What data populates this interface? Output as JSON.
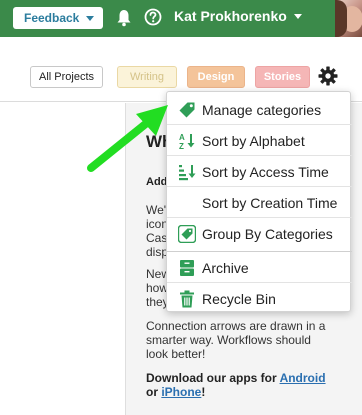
{
  "topbar": {
    "feedback_label": "Feedback",
    "user_name": "Kat Prokhorenko",
    "accent_color": "#3b8a4a"
  },
  "toolbar": {
    "all_projects": "All Projects",
    "writing": "Writing",
    "design": "Design",
    "stories": "Stories"
  },
  "panel": {
    "title_fragment": "Wh",
    "heading_fragment": "Add",
    "p1": [
      "We'",
      "icon",
      "Cas",
      "disp"
    ],
    "p2": [
      "New",
      "how",
      "they"
    ],
    "p3": [
      "Connection arrows are drawn in a",
      "smarter way. Workflows should",
      "look better!"
    ],
    "apps_prefix": "Download our apps for",
    "android": "Android",
    "or": "or",
    "iphone": "iPhone",
    "apps_suffix": "!"
  },
  "menu": {
    "items": [
      {
        "label": "Manage categories",
        "icon": "tag-icon"
      },
      {
        "label": "Sort by Alphabet",
        "icon": "sort-alpha-icon"
      },
      {
        "label": "Sort by Access Time",
        "icon": "sort-time-icon"
      },
      {
        "label": "Sort by Creation Time",
        "icon": ""
      },
      {
        "label": "Group By Categories",
        "icon": "group-tag-icon"
      },
      {
        "label": "Archive",
        "icon": "archive-icon"
      },
      {
        "label": "Recycle Bin",
        "icon": "trash-icon"
      }
    ]
  }
}
